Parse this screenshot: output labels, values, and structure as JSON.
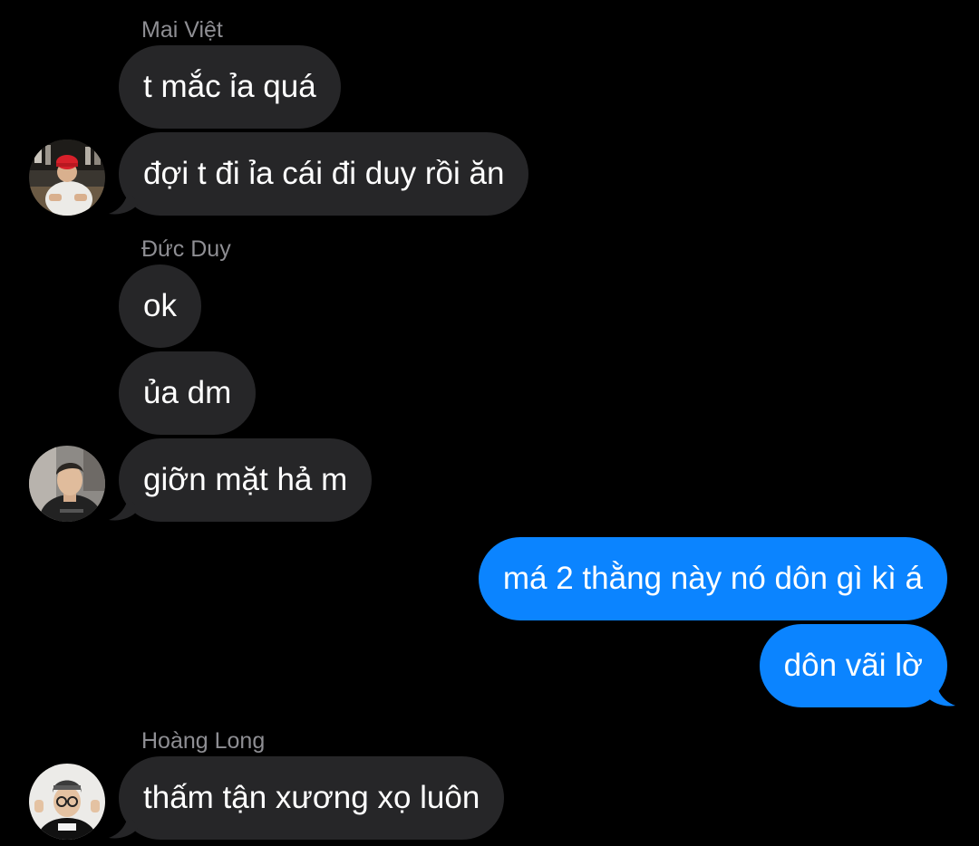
{
  "conversation": {
    "groups": [
      {
        "sender": "Mai Việt",
        "avatar_icon": "avatar-red-cap-icon",
        "messages": [
          "t mắc ỉa quá",
          "đợi t đi ỉa cái đi duy rồi ăn"
        ]
      },
      {
        "sender": "Đức Duy",
        "avatar_icon": "avatar-man-icon",
        "messages": [
          "ok",
          "ủa dm",
          "giỡn mặt hả m"
        ]
      },
      {
        "sender": "",
        "outgoing": true,
        "messages": [
          "má 2 thằng này nó dôn gì kì á",
          "dôn vãi lờ"
        ]
      },
      {
        "sender": "Hoàng Long",
        "avatar_icon": "avatar-glasses-icon",
        "messages": [
          "thấm tận xương xọ luôn"
        ]
      }
    ]
  },
  "colors": {
    "background": "#000000",
    "incoming_bubble": "#262628",
    "outgoing_bubble": "#0b84ff",
    "text": "#ffffff",
    "sender_name": "#8e8e93"
  }
}
